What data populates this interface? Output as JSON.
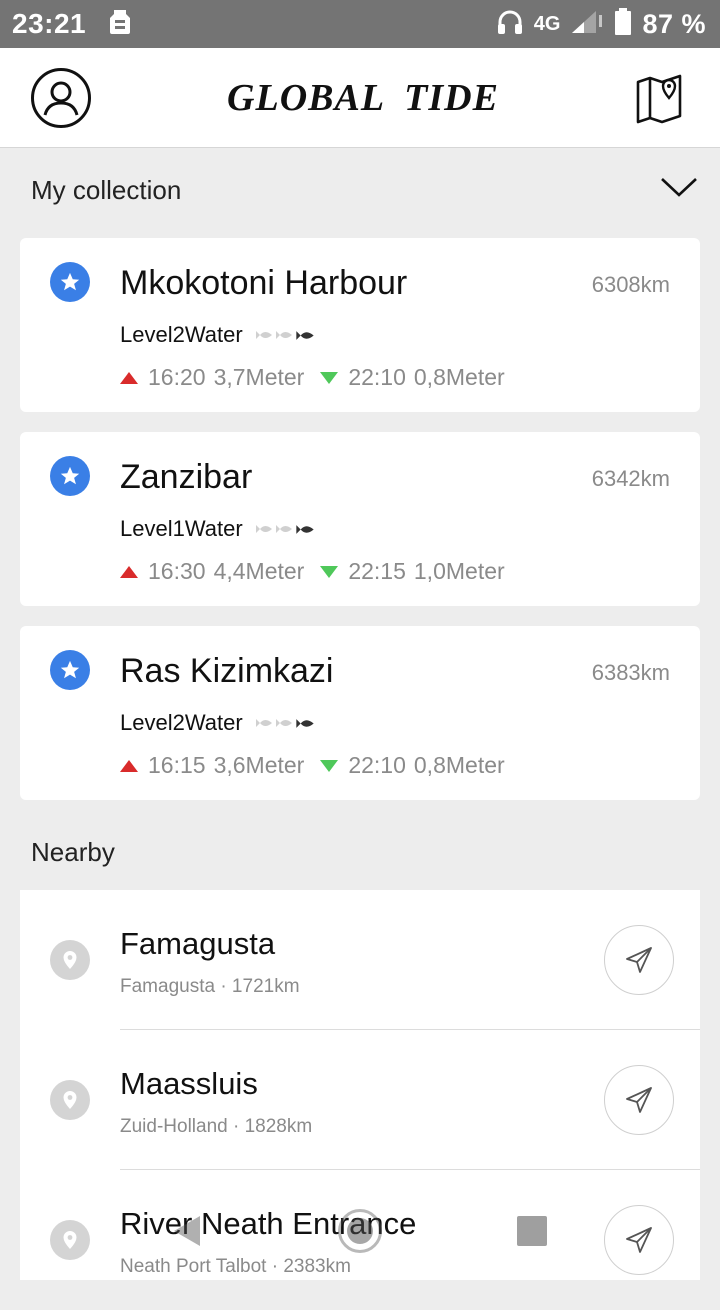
{
  "status_bar": {
    "time": "23:21",
    "network": "4G",
    "battery": "87 %"
  },
  "header": {
    "title": "GLOBAL  TIDE",
    "profile_icon": "user-circle-icon",
    "map_icon": "map-pin-icon"
  },
  "collection": {
    "title": "My collection",
    "items": [
      {
        "name": "Mkokotoni Harbour",
        "distance": "6308km",
        "level": "Level2Water",
        "high_time": "16:20",
        "high_height": "3,7Meter",
        "low_time": "22:10",
        "low_height": "0,8Meter"
      },
      {
        "name": "Zanzibar",
        "distance": "6342km",
        "level": "Level1Water",
        "high_time": "16:30",
        "high_height": "4,4Meter",
        "low_time": "22:15",
        "low_height": "1,0Meter"
      },
      {
        "name": "Ras Kizimkazi",
        "distance": "6383km",
        "level": "Level2Water",
        "high_time": "16:15",
        "high_height": "3,6Meter",
        "low_time": "22:10",
        "low_height": "0,8Meter"
      }
    ]
  },
  "nearby": {
    "title": "Nearby",
    "items": [
      {
        "name": "Famagusta",
        "subtitle": "Famagusta · 1721km"
      },
      {
        "name": "Maassluis",
        "subtitle": "Zuid-Holland · 1828km"
      },
      {
        "name": "River Neath Entrance",
        "subtitle": "Neath Port Talbot · 2383km"
      }
    ]
  },
  "colors": {
    "accent": "#3a7fe6",
    "high_tide": "#d92b2b",
    "low_tide": "#4fc85a",
    "status_bar": "#747474"
  }
}
